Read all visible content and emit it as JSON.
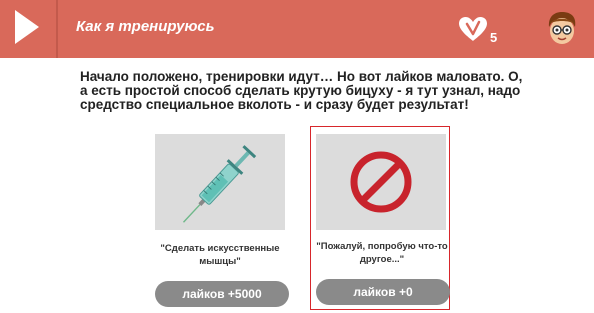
{
  "header": {
    "title": "Как я тренируюсь",
    "likes_count": "5"
  },
  "story": {
    "text": "Начало положено, тренировки идут… Но вот лайков маловато. О, а есть простой способ сделать крутую бицуху - я тут узнал, надо средство специальное вколоть - и сразу будет результат!"
  },
  "options": [
    {
      "caption": "\"Сделать искусственные мышцы\"",
      "button": "лайков +5000",
      "icon": "syringe-icon"
    },
    {
      "caption": "\"Пожалуй, попробую что-то другое...\"",
      "button": "лайков +0",
      "icon": "prohibited-icon",
      "selected": true
    }
  ],
  "colors": {
    "header": "#d9695a",
    "button": "#8a8a8a",
    "selection": "#d7262b",
    "prohibit": "#c8232c"
  }
}
